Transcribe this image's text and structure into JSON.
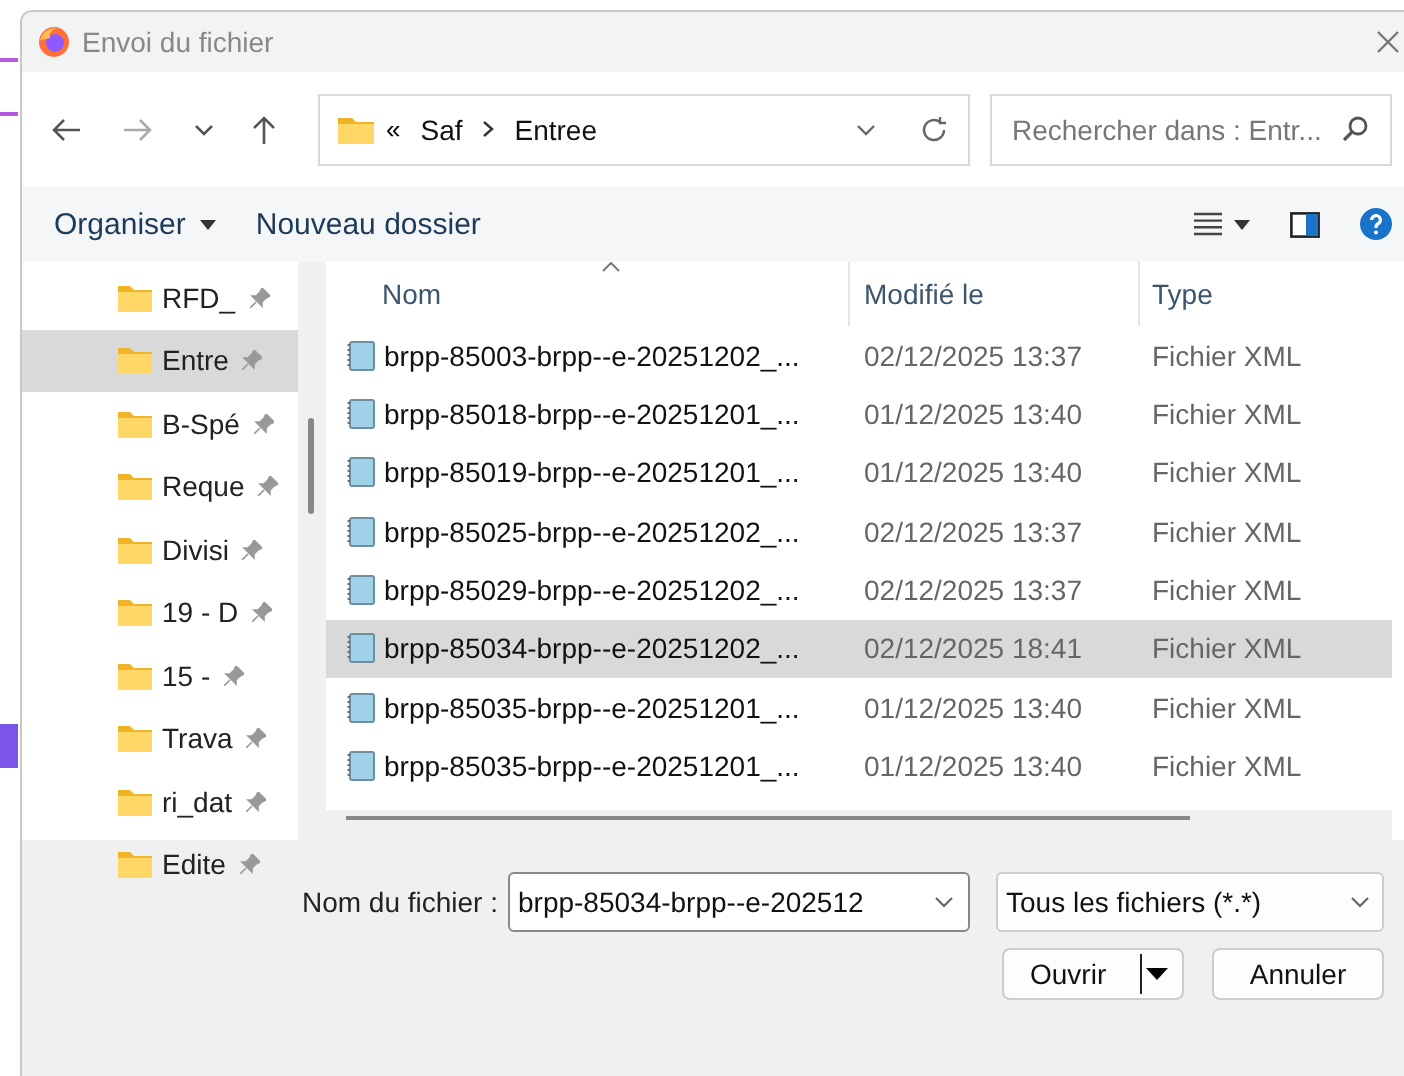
{
  "window": {
    "title": "Envoi du fichier"
  },
  "address_bar": {
    "overflow": "«",
    "path": [
      "Saf",
      "Entree"
    ]
  },
  "search": {
    "placeholder": "Rechercher dans : Entr..."
  },
  "toolbar": {
    "organize": "Organiser",
    "new_folder": "Nouveau dossier"
  },
  "sidebar": {
    "items": [
      {
        "label": "RFD_",
        "selected": false
      },
      {
        "label": "Entre",
        "selected": true
      },
      {
        "label": "B-Spé",
        "selected": false
      },
      {
        "label": "Reque",
        "selected": false
      },
      {
        "label": "Divisi",
        "selected": false
      },
      {
        "label": "19 - D",
        "selected": false
      },
      {
        "label": "15 -",
        "selected": false
      },
      {
        "label": "Trava",
        "selected": false
      },
      {
        "label": "ri_dat",
        "selected": false
      },
      {
        "label": "Edite",
        "selected": false
      }
    ]
  },
  "table": {
    "columns": [
      "Nom",
      "Modifié le",
      "Type"
    ],
    "rows": [
      {
        "name": "brpp-85003-brpp--e-20251202_...",
        "modified": "02/12/2025 13:37",
        "type": "Fichier XML",
        "selected": false
      },
      {
        "name": "brpp-85018-brpp--e-20251201_...",
        "modified": "01/12/2025 13:40",
        "type": "Fichier XML",
        "selected": false
      },
      {
        "name": "brpp-85019-brpp--e-20251201_...",
        "modified": "01/12/2025 13:40",
        "type": "Fichier XML",
        "selected": false
      },
      {
        "name": "brpp-85025-brpp--e-20251202_...",
        "modified": "02/12/2025 13:37",
        "type": "Fichier XML",
        "selected": false
      },
      {
        "name": "brpp-85029-brpp--e-20251202_...",
        "modified": "02/12/2025 13:37",
        "type": "Fichier XML",
        "selected": false
      },
      {
        "name": "brpp-85034-brpp--e-20251202_...",
        "modified": "02/12/2025 18:41",
        "type": "Fichier XML",
        "selected": true
      },
      {
        "name": "brpp-85035-brpp--e-20251201_...",
        "modified": "01/12/2025 13:40",
        "type": "Fichier XML",
        "selected": false
      },
      {
        "name": "brpp-85035-brpp--e-20251201_...",
        "modified": "01/12/2025 13:40",
        "type": "Fichier XML",
        "selected": false
      }
    ]
  },
  "footer": {
    "filename_label": "Nom du fichier :",
    "filename_value": "brpp-85034-brpp--e-202512",
    "filter": "Tous les fichiers (*.*)",
    "open": "Ouvrir",
    "cancel": "Annuler"
  }
}
